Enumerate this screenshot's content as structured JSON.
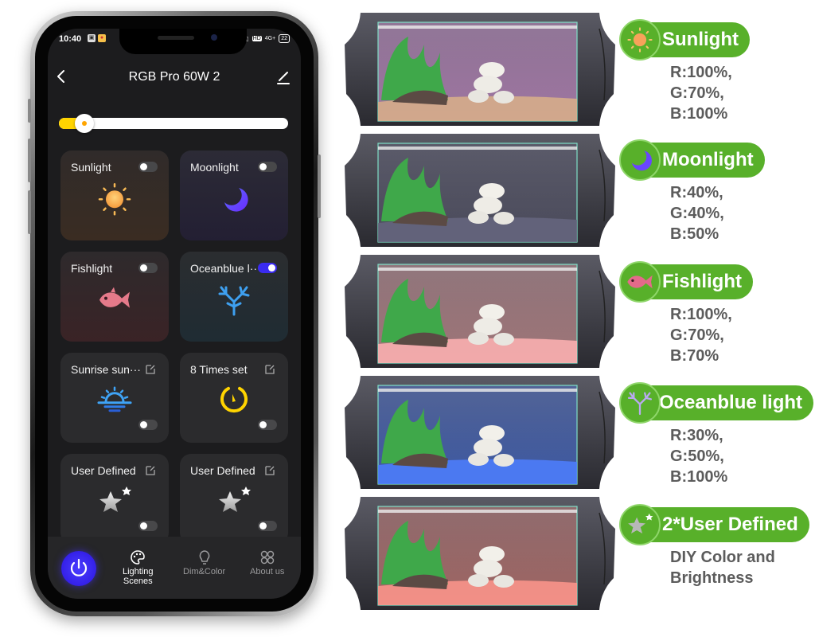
{
  "phone": {
    "status_bar": {
      "time": "10:40",
      "network": "4G+",
      "battery": "22"
    },
    "header": {
      "title": "RGB Pro 60W 2"
    },
    "brightness": {
      "value_fraction": 0.11,
      "fill_color": "#ffd400"
    },
    "scenes": [
      {
        "name": "Sunlight",
        "toggle_position": "top",
        "enabled": false,
        "icon": "sun-icon"
      },
      {
        "name": "Moonlight",
        "toggle_position": "top",
        "enabled": false,
        "icon": "moon-icon"
      },
      {
        "name": "Fishlight",
        "toggle_position": "top",
        "enabled": false,
        "icon": "fish-icon"
      },
      {
        "name": "Oceanblue l···",
        "toggle_position": "top",
        "enabled": true,
        "icon": "coral-icon"
      },
      {
        "name": "Sunrise sun···",
        "toggle_position": "bottom",
        "enabled": false,
        "icon": "sunrise-icon",
        "editable": true
      },
      {
        "name": "8 Times set",
        "toggle_position": "bottom",
        "enabled": false,
        "icon": "timer-icon",
        "editable": true
      },
      {
        "name": "User Defined",
        "toggle_position": "bottom",
        "enabled": false,
        "icon": "star-icon",
        "editable": true
      },
      {
        "name": "User Defined",
        "toggle_position": "bottom",
        "enabled": false,
        "icon": "star-icon",
        "editable": true
      }
    ],
    "bottom_nav": {
      "items": [
        {
          "label": "Lighting\nScenes",
          "line1": "Lighting",
          "line2": "Scenes",
          "active": true
        },
        {
          "label": "Dim&Color",
          "active": false
        },
        {
          "label": "About us",
          "active": false
        }
      ]
    }
  },
  "presets": [
    {
      "title": "Sunlight",
      "lines": [
        "R:100%,",
        "G:70%,",
        "B:100%"
      ],
      "r": 100,
      "g": 70,
      "b": 100
    },
    {
      "title": "Moonlight",
      "lines": [
        "R:40%,",
        "G:40%,",
        "B:50%"
      ],
      "r": 40,
      "g": 40,
      "b": 50
    },
    {
      "title": "Fishlight",
      "lines": [
        "R:100%,",
        "G:70%,",
        "B:70%"
      ],
      "r": 100,
      "g": 70,
      "b": 70
    },
    {
      "title": "Oceanblue light",
      "lines": [
        "R:30%,",
        "G:50%,",
        "B:100%"
      ],
      "r": 30,
      "g": 50,
      "b": 100
    },
    {
      "title": "2*User Defined",
      "lines": [
        "DIY Color and",
        "Brightness"
      ]
    }
  ],
  "colors": {
    "accent_green": "#58b02a",
    "toggle_on": "#3a2bf0",
    "power_button": "#3420e8",
    "label_text": "#5c5c5c"
  }
}
